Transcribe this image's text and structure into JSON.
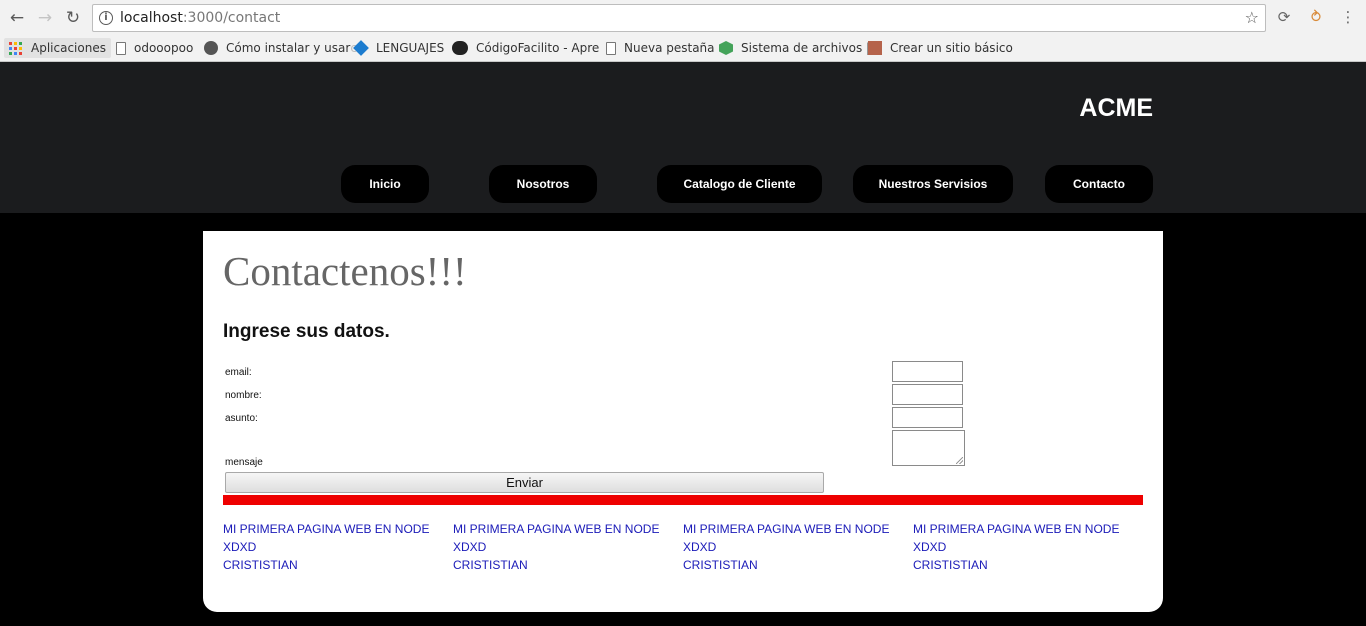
{
  "browser": {
    "url_host": "localhost",
    "url_path": ":3000/contact",
    "bookmarks": [
      {
        "label": "Aplicaciones"
      },
      {
        "label": "odooopoo"
      },
      {
        "label": "Cómo instalar y usar"
      },
      {
        "label": "LENGUAJES"
      },
      {
        "label": "CódigoFacilito - Apre"
      },
      {
        "label": "Nueva pestaña"
      },
      {
        "label": "Sistema de archivos |"
      },
      {
        "label": "Crear un sitio básico"
      }
    ]
  },
  "site": {
    "brand": "ACME",
    "menu": [
      {
        "label": "Inicio"
      },
      {
        "label": "Nosotros"
      },
      {
        "label": "Catalogo de Cliente"
      },
      {
        "label": "Nuestros Servisios"
      },
      {
        "label": "Contacto"
      }
    ]
  },
  "contact": {
    "title": "Contactenos!!!",
    "subtitle": "Ingrese sus datos.",
    "labels": {
      "email": "email:",
      "nombre": "nombre:",
      "asunto": "asunto:",
      "mensaje": "mensaje"
    },
    "submit_label": "Enviar",
    "accent_color": "#ee0000"
  },
  "footer": {
    "columns": [
      {
        "line1": "MI PRIMERA PAGINA WEB EN NODE",
        "line2": "XDXD",
        "line3": "CRISTISTIAN"
      },
      {
        "line1": "MI PRIMERA PAGINA WEB EN NODE",
        "line2": "XDXD",
        "line3": "CRISTISTIAN"
      },
      {
        "line1": "MI PRIMERA PAGINA WEB EN NODE",
        "line2": "XDXD",
        "line3": "CRISTISTIAN"
      },
      {
        "line1": "MI PRIMERA PAGINA WEB EN NODE",
        "line2": "XDXD",
        "line3": "CRISTISTIAN"
      }
    ]
  }
}
